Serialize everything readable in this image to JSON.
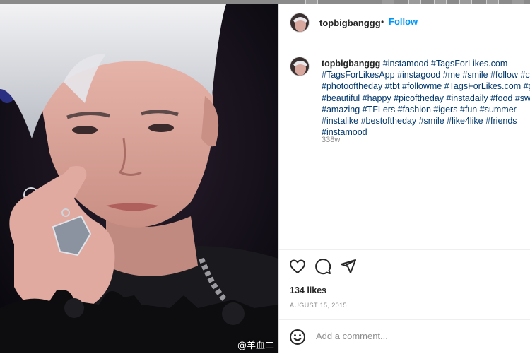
{
  "post": {
    "username": "topbigbanggg",
    "follow_label": "Follow",
    "separator": "•",
    "caption_tags": "#instamood #TagsForLikes.com #TagsForLikesApp #instagood #me #smile #follow #cute #photooftheday #tbt #followme #TagsForLikes.com #girl #beautiful #happy #picoftheday #instadaily #food #swag #amazing #TFLers #fashion #igers #fun #summer #instalike #bestoftheday #smile #like4like #friends #instamood",
    "time_ago": "338w",
    "likes": "134 likes",
    "date": "AUGUST 15, 2015",
    "comment_placeholder": "Add a comment..."
  },
  "photo": {
    "watermark": "@羊血二"
  },
  "icons": {
    "like": "heart-icon",
    "comment": "comment-bubble-icon",
    "share": "paper-plane-icon",
    "emoji": "smiley-icon"
  },
  "colors": {
    "link": "#0095f6",
    "hashtag": "#00376b",
    "text": "#262626",
    "muted": "#8e8e8e"
  }
}
